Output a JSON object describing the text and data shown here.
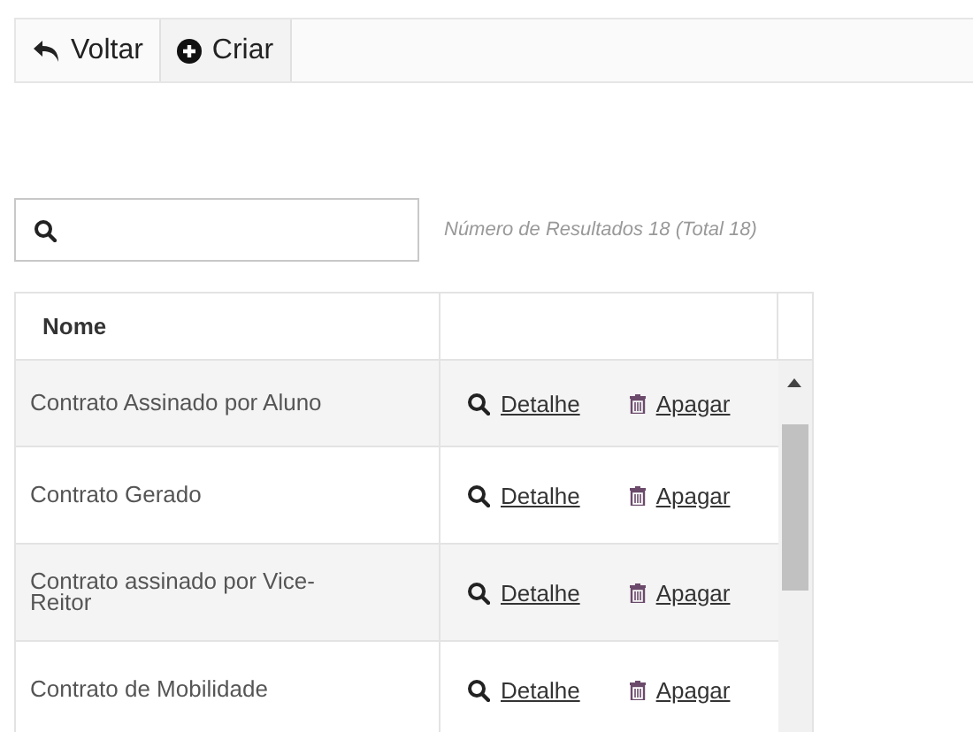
{
  "toolbar": {
    "buttons": [
      {
        "label": "Voltar",
        "kind": "back"
      },
      {
        "label": "Criar",
        "kind": "create"
      }
    ]
  },
  "result_count": "Número de Resultados 18 (Total 18)",
  "table": {
    "columns": [
      "Nome"
    ],
    "rows": [
      {
        "name": "Contrato Assinado por Aluno",
        "detail": "Detalhe",
        "delete": "Apagar"
      },
      {
        "name": "Contrato Gerado",
        "detail": "Detalhe",
        "delete": "Apagar"
      },
      {
        "name": "Contrato assinado por Vice-Reitor",
        "detail": "Detalhe",
        "delete": "Apagar"
      },
      {
        "name": "Contrato de Mobilidade",
        "detail": "Detalhe",
        "delete": "Apagar"
      }
    ]
  }
}
